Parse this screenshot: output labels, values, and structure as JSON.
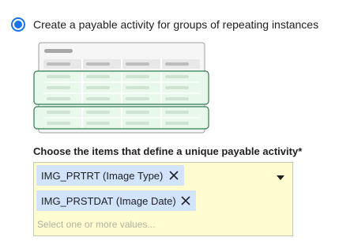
{
  "option": {
    "label": "Create a payable activity for groups of repeating instances",
    "selected": true
  },
  "field": {
    "label": "Choose the items that define a unique payable activity*",
    "chips": [
      {
        "label": "IMG_PRTRT (Image Type)"
      },
      {
        "label": "IMG_PRSTDAT (Image Date)"
      }
    ],
    "placeholder": "Select one or more values..."
  },
  "colors": {
    "accent": "#1a73e8",
    "field_background": "#fffdd0",
    "chip_background": "#d2e3fc",
    "group_border": "#2e7d4f",
    "group_fill": "#e8f8ea"
  },
  "icons": {
    "radio": "radio-selected-icon",
    "chip_remove": "close-icon",
    "dropdown": "caret-down-icon"
  }
}
